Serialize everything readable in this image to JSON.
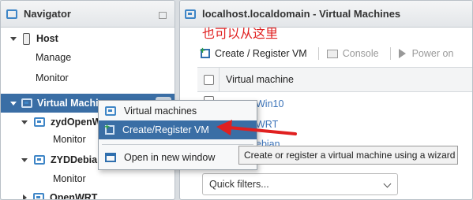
{
  "navigator": {
    "title": "Navigator",
    "host_label": "Host",
    "manage_label": "Manage",
    "monitor_label": "Monitor",
    "vms_label": "Virtual Machines",
    "vm1_label": "zydOpenW",
    "vm1_monitor": "Monitor",
    "vm2_label": "ZYDDebia",
    "vm2_monitor": "Monitor",
    "vm3_label": "OpenWRT"
  },
  "main": {
    "title": "localhost.localdomain - Virtual Machines",
    "annotation_text": "也可以从这里",
    "toolbar": {
      "create_label": "Create / Register VM",
      "console_label": "Console",
      "poweron_label": "Power on"
    },
    "grid": {
      "column_header": "Virtual machine",
      "row1": "Win10",
      "row2": "WRT",
      "row3": "ebian"
    },
    "quick_filters_placeholder": "Quick filters..."
  },
  "context_menu": {
    "header": "Virtual machines",
    "create": "Create/Register VM",
    "open_window": "Open in new window"
  },
  "tooltip": "Create or register a virtual machine using a wizard",
  "colors": {
    "accent": "#3a6ea5",
    "annotation": "#e02020",
    "link": "#3b73b9"
  }
}
